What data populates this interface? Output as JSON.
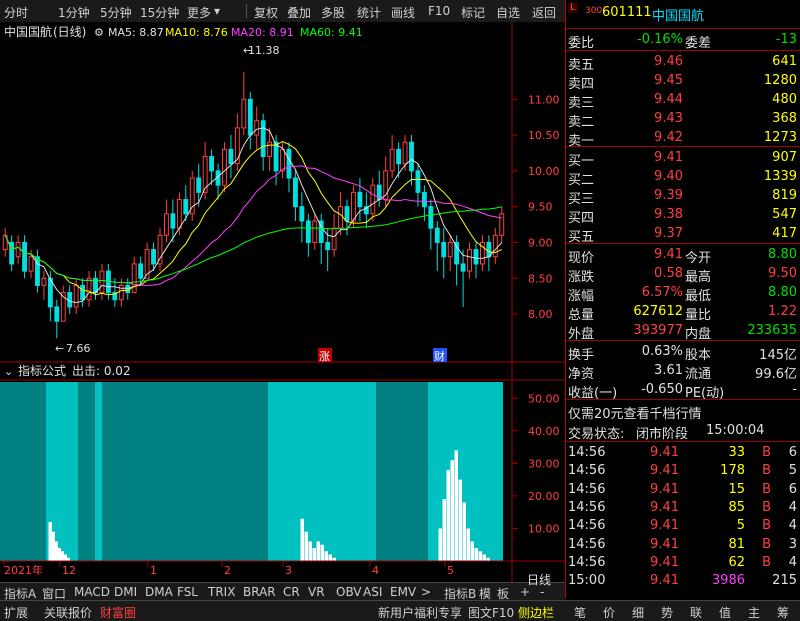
{
  "toolbar": {
    "left": [
      "分时",
      "1分钟",
      "5分钟",
      "15分钟",
      "更多"
    ],
    "right": [
      "复权",
      "叠加",
      "多股",
      "统计",
      "画线",
      "F10",
      "标记",
      "自选",
      "返回"
    ]
  },
  "chart_header": {
    "stock": "中国国航",
    "period": "(日线)",
    "ma5": "MA5: 8.87",
    "ma10": "MA10: 8.76",
    "ma20": "MA20: 8.91",
    "ma60": "MA60: 9.41",
    "high_label": "11.38",
    "low_label": "7.66",
    "marker_zhang": "涨",
    "marker_cai": "财"
  },
  "indicator_header": {
    "name": "指标公式",
    "title": "出击: 0.02"
  },
  "chart_data": {
    "type": "candlestick",
    "price_axis": {
      "ticks": [
        8.0,
        8.5,
        9.0,
        9.5,
        10.0,
        10.5,
        11.0
      ],
      "labels": [
        "8.00",
        "8.50",
        "9.00",
        "9.50",
        "10.00",
        "10.50",
        "11.00"
      ],
      "range": [
        7.4,
        11.8
      ]
    },
    "indicator_axis": {
      "ticks": [
        10,
        20,
        30,
        40,
        50
      ],
      "labels": [
        "10.00",
        "20.00",
        "30.00",
        "40.00",
        "50.00"
      ],
      "range": [
        0,
        55
      ]
    },
    "time_axis": [
      "2021年",
      "12",
      "1",
      "2",
      "3",
      "4",
      "5"
    ],
    "candles": [
      [
        8.9,
        9.1,
        8.8,
        9.2
      ],
      [
        9.0,
        8.7,
        8.6,
        9.1
      ],
      [
        8.8,
        9.0,
        8.7,
        9.1
      ],
      [
        9.0,
        8.6,
        8.5,
        9.1
      ],
      [
        8.6,
        8.8,
        8.5,
        8.9
      ],
      [
        8.8,
        8.4,
        8.3,
        8.9
      ],
      [
        8.4,
        8.5,
        8.2,
        8.6
      ],
      [
        8.5,
        8.1,
        7.9,
        8.6
      ],
      [
        8.1,
        7.9,
        7.66,
        8.2
      ],
      [
        7.9,
        8.3,
        7.9,
        8.4
      ],
      [
        8.3,
        8.1,
        8.0,
        8.4
      ],
      [
        8.1,
        8.4,
        8.0,
        8.5
      ],
      [
        8.4,
        8.2,
        8.1,
        8.5
      ],
      [
        8.2,
        8.5,
        8.1,
        8.6
      ],
      [
        8.5,
        8.3,
        8.2,
        8.6
      ],
      [
        8.3,
        8.6,
        8.2,
        8.7
      ],
      [
        8.6,
        8.3,
        8.2,
        8.7
      ],
      [
        8.3,
        8.2,
        8.1,
        8.5
      ],
      [
        8.2,
        8.4,
        8.1,
        8.5
      ],
      [
        8.4,
        8.3,
        8.2,
        8.5
      ],
      [
        8.3,
        8.7,
        8.3,
        8.8
      ],
      [
        8.7,
        8.5,
        8.4,
        8.8
      ],
      [
        8.5,
        8.9,
        8.5,
        9.0
      ],
      [
        8.9,
        8.7,
        8.6,
        9.0
      ],
      [
        8.7,
        9.1,
        8.6,
        9.2
      ],
      [
        9.1,
        9.4,
        9.0,
        9.6
      ],
      [
        9.4,
        9.2,
        9.0,
        9.6
      ],
      [
        9.2,
        9.6,
        9.1,
        9.7
      ],
      [
        9.6,
        9.4,
        9.3,
        9.8
      ],
      [
        9.4,
        9.9,
        9.3,
        10.0
      ],
      [
        9.9,
        9.7,
        9.5,
        10.1
      ],
      [
        9.7,
        10.2,
        9.6,
        10.4
      ],
      [
        10.2,
        10.0,
        9.8,
        10.3
      ],
      [
        10.0,
        9.8,
        9.6,
        10.1
      ],
      [
        9.8,
        10.3,
        9.7,
        10.4
      ],
      [
        10.3,
        10.1,
        9.9,
        10.5
      ],
      [
        10.1,
        10.6,
        10.0,
        10.8
      ],
      [
        10.6,
        11.0,
        10.5,
        11.38
      ],
      [
        11.0,
        10.5,
        10.3,
        11.1
      ],
      [
        10.5,
        10.7,
        10.3,
        10.9
      ],
      [
        10.7,
        10.2,
        10.0,
        10.8
      ],
      [
        10.2,
        10.4,
        10.0,
        10.6
      ],
      [
        10.4,
        10.0,
        9.8,
        10.5
      ],
      [
        10.0,
        10.3,
        9.9,
        10.4
      ],
      [
        10.3,
        9.9,
        9.7,
        10.4
      ],
      [
        9.9,
        9.5,
        9.3,
        10.0
      ],
      [
        9.5,
        9.3,
        9.0,
        9.7
      ],
      [
        9.3,
        9.0,
        8.8,
        9.4
      ],
      [
        9.0,
        9.3,
        8.9,
        9.4
      ],
      [
        9.3,
        9.0,
        8.7,
        9.4
      ],
      [
        9.0,
        8.9,
        8.6,
        9.2
      ],
      [
        8.9,
        9.2,
        8.8,
        9.4
      ],
      [
        9.2,
        9.5,
        9.1,
        9.7
      ],
      [
        9.5,
        9.3,
        9.1,
        9.6
      ],
      [
        9.3,
        9.7,
        9.2,
        9.8
      ],
      [
        9.7,
        9.5,
        9.3,
        9.9
      ],
      [
        9.5,
        9.4,
        9.2,
        9.7
      ],
      [
        9.4,
        9.8,
        9.3,
        9.9
      ],
      [
        9.8,
        9.6,
        9.5,
        10.0
      ],
      [
        9.6,
        10.0,
        9.5,
        10.2
      ],
      [
        10.0,
        10.3,
        9.9,
        10.5
      ],
      [
        10.3,
        10.1,
        9.9,
        10.4
      ],
      [
        10.1,
        10.4,
        10.0,
        10.5
      ],
      [
        10.4,
        10.0,
        9.8,
        10.5
      ],
      [
        10.0,
        9.7,
        9.5,
        10.1
      ],
      [
        9.7,
        9.5,
        9.3,
        9.8
      ],
      [
        9.5,
        9.2,
        8.9,
        9.6
      ],
      [
        9.2,
        9.0,
        8.6,
        9.3
      ],
      [
        9.0,
        8.8,
        8.5,
        9.2
      ],
      [
        8.8,
        9.0,
        8.6,
        9.1
      ],
      [
        9.0,
        8.7,
        8.4,
        9.1
      ],
      [
        8.7,
        8.6,
        8.1,
        8.9
      ],
      [
        8.6,
        8.9,
        8.5,
        9.0
      ],
      [
        8.9,
        8.7,
        8.5,
        9.0
      ],
      [
        8.7,
        9.0,
        8.6,
        9.1
      ],
      [
        9.0,
        8.8,
        8.6,
        9.1
      ],
      [
        8.8,
        9.1,
        8.7,
        9.2
      ],
      [
        9.1,
        9.4,
        9.0,
        9.5
      ]
    ],
    "indicator_bars": [
      [
        0,
        46,
        "#008080"
      ],
      [
        46,
        78,
        "#00c0c0"
      ],
      [
        78,
        95,
        "#008080"
      ],
      [
        95,
        102,
        "#00c0c0"
      ],
      [
        102,
        268,
        "#008080"
      ],
      [
        268,
        296,
        "#00c0c0"
      ],
      [
        296,
        376,
        "#00c0c0"
      ],
      [
        376,
        428,
        "#008080"
      ],
      [
        428,
        503,
        "#00c0c0"
      ]
    ],
    "indicator_spikes": [
      [
        50,
        12
      ],
      [
        53,
        9
      ],
      [
        56,
        6
      ],
      [
        59,
        4
      ],
      [
        62,
        3
      ],
      [
        65,
        2
      ],
      [
        68,
        1
      ],
      [
        302,
        13
      ],
      [
        306,
        9
      ],
      [
        310,
        6
      ],
      [
        314,
        4
      ],
      [
        318,
        6
      ],
      [
        322,
        5
      ],
      [
        326,
        3
      ],
      [
        330,
        2
      ],
      [
        334,
        1
      ],
      [
        440,
        10
      ],
      [
        444,
        19
      ],
      [
        448,
        28
      ],
      [
        452,
        31
      ],
      [
        456,
        34
      ],
      [
        460,
        25
      ],
      [
        464,
        18
      ],
      [
        468,
        10
      ],
      [
        472,
        6
      ],
      [
        476,
        4
      ],
      [
        480,
        3
      ],
      [
        484,
        2
      ],
      [
        488,
        1
      ]
    ]
  },
  "quote": {
    "code": "601111",
    "name": "中国国航",
    "webi_label": "委比",
    "webi_value": "-0.16%",
    "weicha_label": "委差",
    "weicha_value": "-13",
    "sell": [
      {
        "label": "卖五",
        "price": "9.46",
        "vol": "641"
      },
      {
        "label": "卖四",
        "price": "9.45",
        "vol": "1280"
      },
      {
        "label": "卖三",
        "price": "9.44",
        "vol": "480"
      },
      {
        "label": "卖二",
        "price": "9.43",
        "vol": "368"
      },
      {
        "label": "卖一",
        "price": "9.42",
        "vol": "1273"
      }
    ],
    "buy": [
      {
        "label": "买一",
        "price": "9.41",
        "vol": "907"
      },
      {
        "label": "买二",
        "price": "9.40",
        "vol": "1339"
      },
      {
        "label": "买三",
        "price": "9.39",
        "vol": "819"
      },
      {
        "label": "买四",
        "price": "9.38",
        "vol": "547"
      },
      {
        "label": "买五",
        "price": "9.37",
        "vol": "417"
      }
    ],
    "stats": [
      {
        "l1": "现价",
        "v1": "9.41",
        "c1": "r",
        "l2": "今开",
        "v2": "8.80",
        "c2": "g"
      },
      {
        "l1": "涨跌",
        "v1": "0.58",
        "c1": "r",
        "l2": "最高",
        "v2": "9.50",
        "c2": "r"
      },
      {
        "l1": "涨幅",
        "v1": "6.57%",
        "c1": "r",
        "l2": "最低",
        "v2": "8.80",
        "c2": "g"
      },
      {
        "l1": "总量",
        "v1": "627612",
        "c1": "y",
        "l2": "量比",
        "v2": "1.22",
        "c2": "r"
      },
      {
        "l1": "外盘",
        "v1": "393977",
        "c1": "r",
        "l2": "内盘",
        "v2": "233635",
        "c2": "g"
      }
    ],
    "stats2": [
      {
        "l1": "换手",
        "v1": "0.63%",
        "l2": "股本",
        "v2": "145亿"
      },
      {
        "l1": "净资",
        "v1": "3.61",
        "l2": "流通",
        "v2": "99.6亿"
      },
      {
        "l1": "收益(一)",
        "v1": "-0.650",
        "l2": "PE(动)",
        "v2": "-"
      }
    ],
    "promo": "仅需20元查看千档行情",
    "trade_status_label": "交易状态:",
    "trade_status": "闭市阶段",
    "trade_time": "15:00:04",
    "ticks": [
      {
        "t": "14:56",
        "p": "9.41",
        "v": "33",
        "bs": "B",
        "n": "6"
      },
      {
        "t": "14:56",
        "p": "9.41",
        "v": "178",
        "bs": "B",
        "n": "5"
      },
      {
        "t": "14:56",
        "p": "9.41",
        "v": "15",
        "bs": "B",
        "n": "6"
      },
      {
        "t": "14:56",
        "p": "9.41",
        "v": "85",
        "bs": "B",
        "n": "4"
      },
      {
        "t": "14:56",
        "p": "9.41",
        "v": "5",
        "bs": "B",
        "n": "4"
      },
      {
        "t": "14:56",
        "p": "9.41",
        "v": "81",
        "bs": "B",
        "n": "3"
      },
      {
        "t": "14:56",
        "p": "9.41",
        "v": "62",
        "bs": "B",
        "n": "4"
      },
      {
        "t": "15:00",
        "p": "9.41",
        "v": "3986",
        "bs": "",
        "n": "215"
      }
    ]
  },
  "tabs": [
    "指标A",
    "窗口",
    "MACD",
    "DMI",
    "DMA",
    "FSL",
    "TRIX",
    "BRAR",
    "CR",
    "VR",
    "OBV",
    "ASI",
    "EMV",
    ">",
    "指标B",
    "模",
    "板",
    "+",
    "-",
    "日线"
  ],
  "status": {
    "left": [
      "扩展",
      "关联报价",
      "财富圈"
    ],
    "mid": [
      "新用户福利专享",
      "图文F10",
      "侧边栏"
    ],
    "right": [
      "笔",
      "价",
      "细",
      "势",
      "联",
      "值",
      "主",
      "筹"
    ]
  }
}
